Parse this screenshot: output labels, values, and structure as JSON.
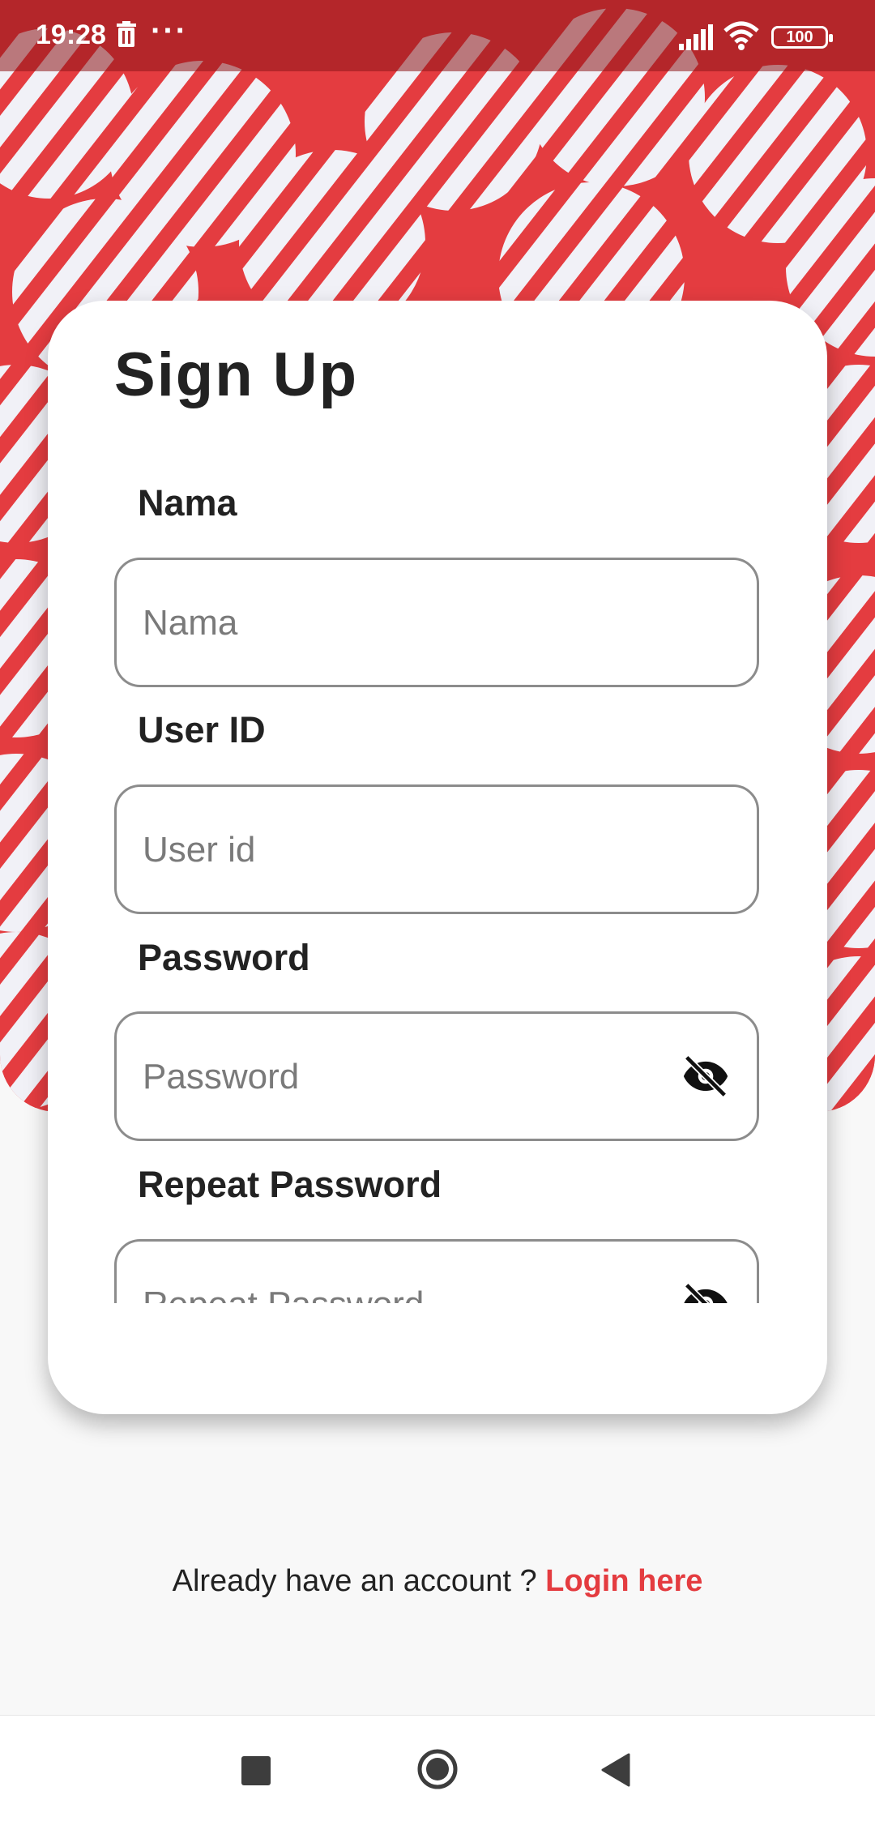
{
  "status_bar": {
    "time": "19:28",
    "overflow_dots": "···",
    "battery": "100"
  },
  "colors": {
    "accent": "#e43c40",
    "text": "#222222",
    "border": "#8c8c8c"
  },
  "signup": {
    "title": "Sign Up",
    "fields": [
      {
        "label": "Nama",
        "placeholder": "Nama"
      },
      {
        "label": "User ID",
        "placeholder": "User id"
      },
      {
        "label": "Password",
        "placeholder": "Password",
        "icon": "eye-off-icon"
      },
      {
        "label": "Repeat Password",
        "placeholder": "Repeat Password",
        "icon": "eye-off-icon"
      }
    ]
  },
  "footer": {
    "prompt": "Already have an account ?",
    "login_link": "Login here"
  },
  "nav_bar": {
    "icons": [
      "recents-icon",
      "home-icon",
      "back-icon"
    ]
  }
}
